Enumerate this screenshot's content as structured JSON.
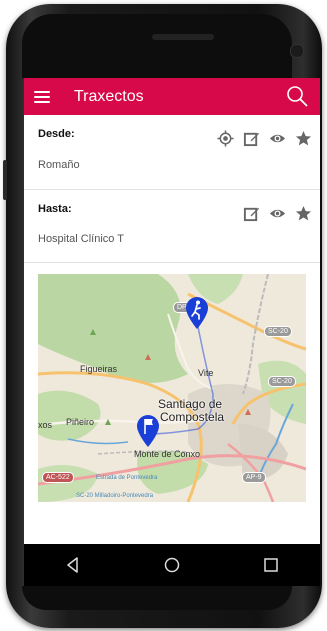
{
  "appbar": {
    "title": "Traxectos",
    "menu_icon": "menu-icon",
    "search_icon": "search-icon",
    "color": "#d8094a"
  },
  "from": {
    "label": "Desde:",
    "value": "Romaño",
    "icons": [
      "my-location-icon",
      "edit-icon",
      "view-icon",
      "favorite-icon"
    ]
  },
  "to": {
    "label": "Hasta:",
    "value": "Hospital Clínico T",
    "icons": [
      "edit-icon",
      "view-icon",
      "favorite-icon"
    ]
  },
  "map": {
    "places": {
      "figueiras": "Figueiras",
      "vite": "Vite",
      "city_line1": "Santiago de",
      "city_line2": "Compostela",
      "pinheiro": "Piñeiro",
      "xos": "xos",
      "monte_de_conxo": "Monte de Conxo",
      "road_dp": "DP"
    },
    "roads": {
      "sc20_a": "SC-20",
      "sc20_b": "SC-20",
      "ac522": "AC-522",
      "ap9": "AP-9"
    },
    "footer1": "Estrada de Pontevedra",
    "footer2": "SC-20 Milladoiro-Pontevedra",
    "start_marker": "walking-person-marker",
    "end_marker": "flag-marker"
  },
  "navbar": {
    "back": "back-icon",
    "home": "home-icon",
    "recents": "recents-icon"
  }
}
